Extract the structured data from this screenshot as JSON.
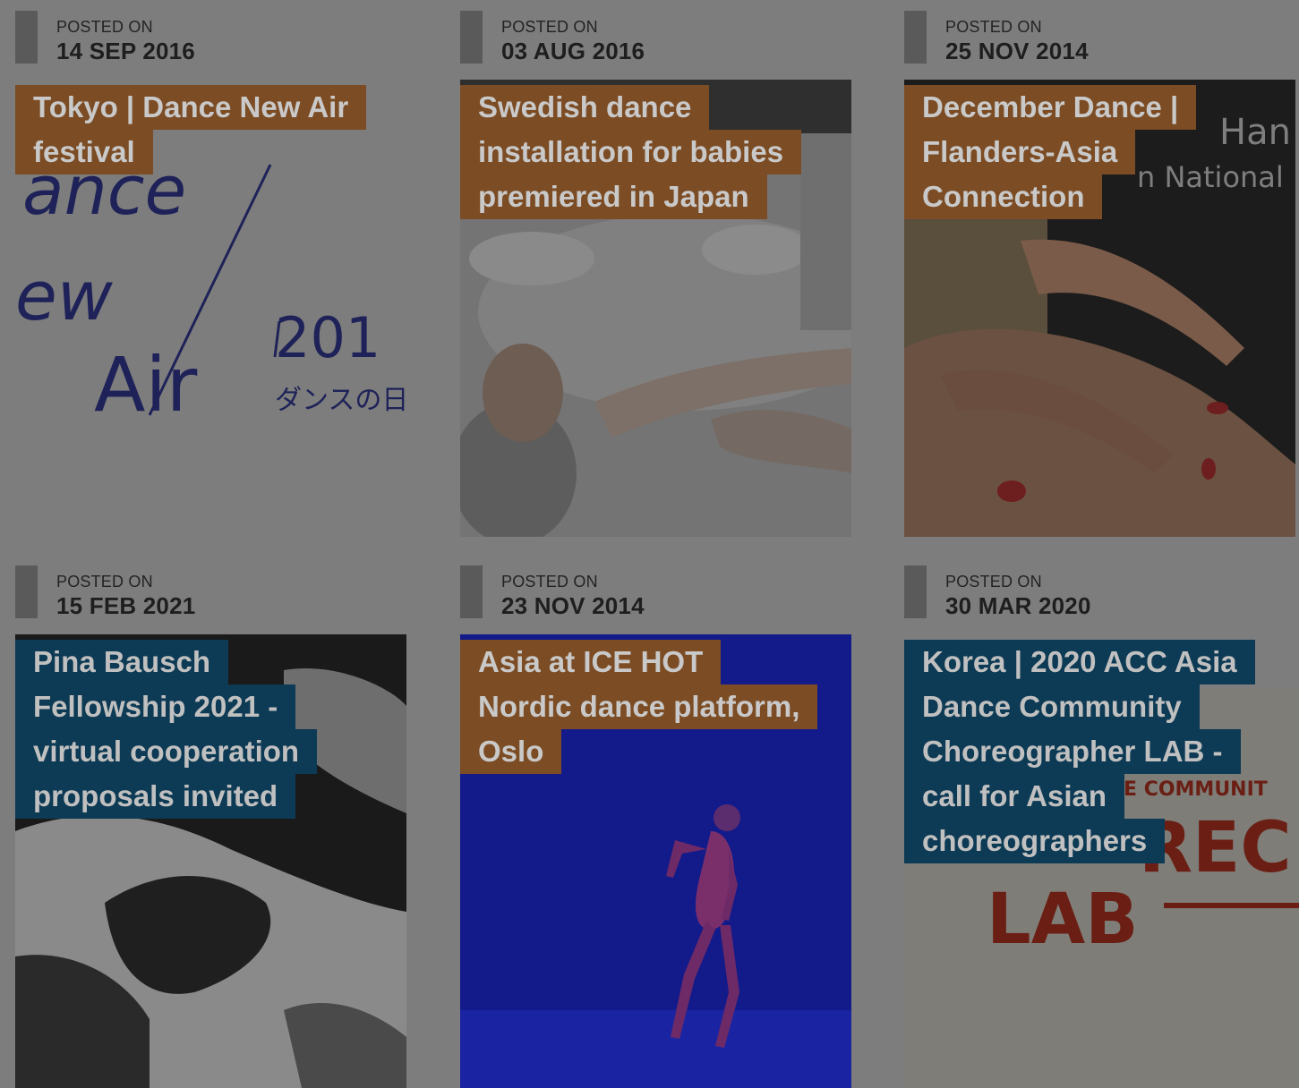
{
  "cards": [
    {
      "posted_label": "POSTED ON",
      "date": "14 SEP 2016",
      "title_lines": [
        "Tokyo | Dance New Air",
        "festival"
      ],
      "image_text": [
        "ance",
        "ew",
        "Air",
        "201",
        "ダンスの日"
      ]
    },
    {
      "posted_label": "POSTED ON",
      "date": "03 AUG 2016",
      "title_lines": [
        "Swedish dance",
        "installation for babies",
        "premiered in Japan"
      ]
    },
    {
      "posted_label": "POSTED ON",
      "date": "25 NOV 2014",
      "title_lines": [
        "December Dance |",
        "Flanders-Asia",
        "Connection"
      ],
      "image_text": [
        "Han",
        "n National"
      ]
    },
    {
      "posted_label": "POSTED ON",
      "date": "15 FEB 2021",
      "title_lines": [
        "Pina Bausch",
        "Fellowship 2021 -",
        "virtual cooperation",
        "proposals invited"
      ]
    },
    {
      "posted_label": "POSTED ON",
      "date": "23 NOV 2014",
      "title_lines": [
        "Asia at ICE HOT",
        "Nordic dance platform,",
        "Oslo"
      ]
    },
    {
      "posted_label": "POSTED ON",
      "date": "30 MAR 2020",
      "title_lines": [
        "Korea | 2020 ACC Asia",
        "Dance Community",
        "Choreographer LAB -",
        "call for Asian",
        "choreographers"
      ],
      "image_text": [
        "E COMMUNIT",
        "REC",
        "LAB"
      ]
    }
  ],
  "colors": {
    "overlay_bg": "#7d7d7d",
    "title_orange": "#7c4c24",
    "title_blue": "#0d3a54"
  }
}
